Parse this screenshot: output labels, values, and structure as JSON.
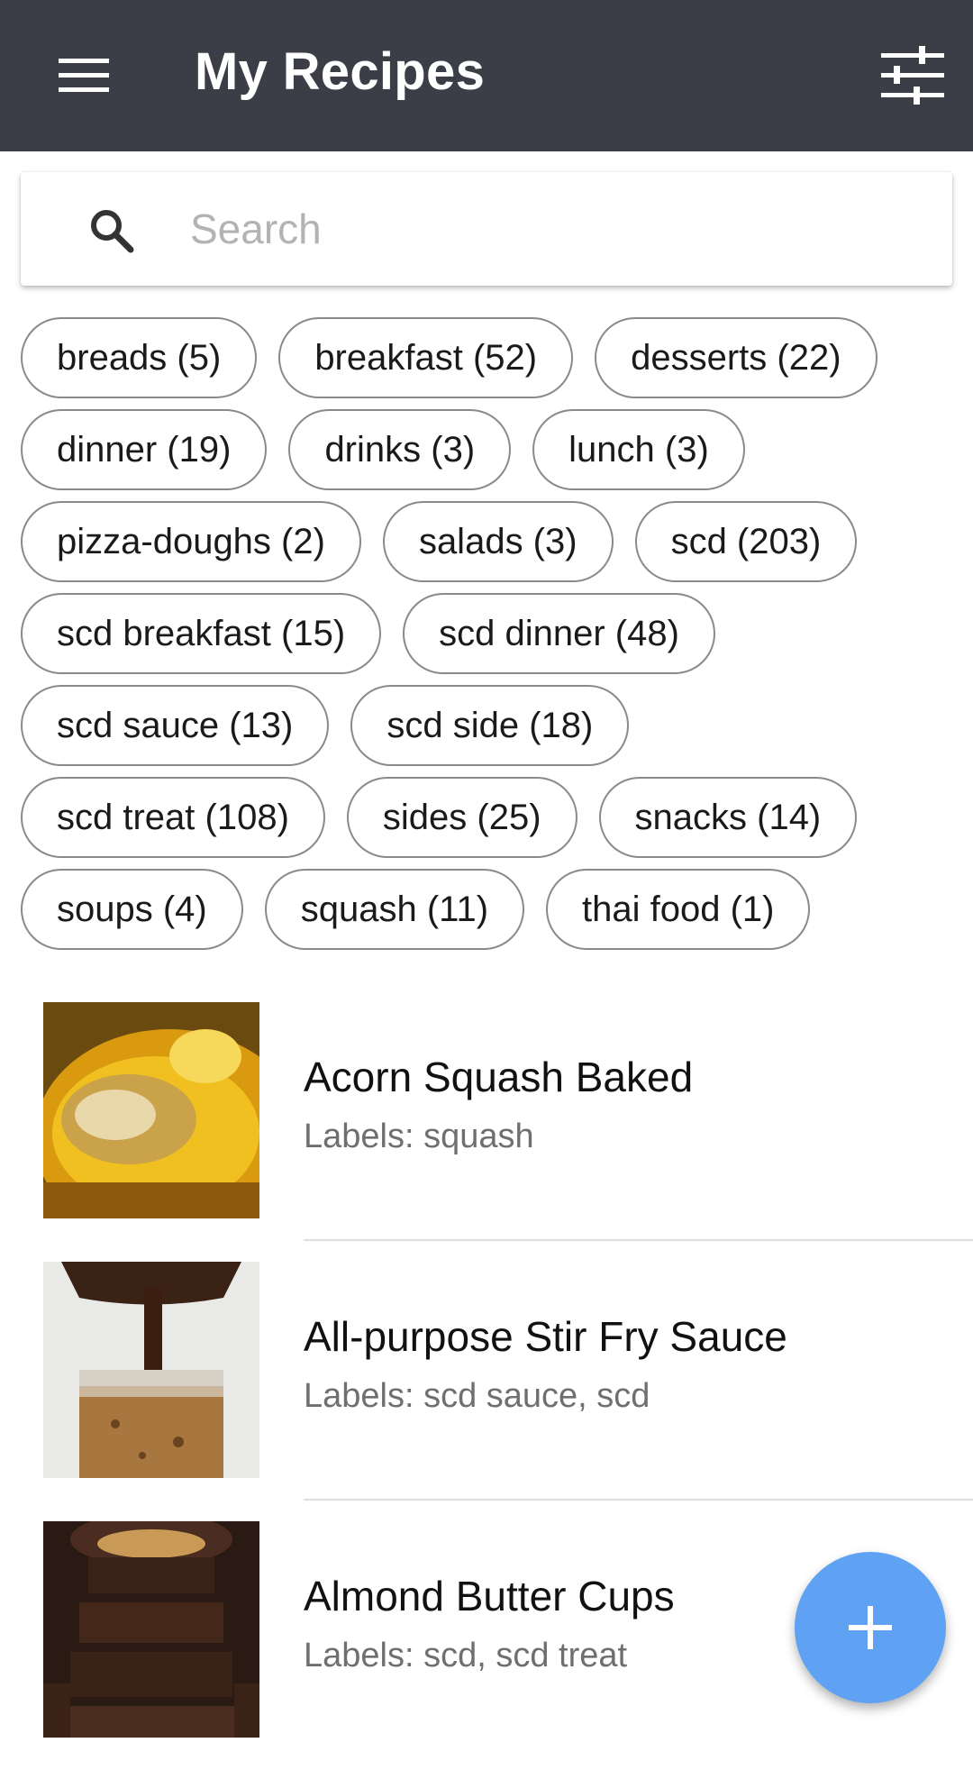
{
  "header": {
    "title": "My Recipes",
    "menu_icon": "hamburger-menu-icon",
    "filter_icon": "sliders-filter-icon",
    "background": "#3b3e47"
  },
  "search": {
    "placeholder": "Search",
    "value": "",
    "icon": "search-icon"
  },
  "categories": {
    "rows": [
      [
        "breads (5)",
        "breakfast (52)",
        "desserts (22)"
      ],
      [
        "dinner (19)",
        "drinks (3)",
        "lunch (3)"
      ],
      [
        "pizza-doughs (2)",
        "salads (3)",
        "scd (203)"
      ],
      [
        "scd breakfast (15)",
        "scd dinner (48)"
      ],
      [
        "scd sauce (13)",
        "scd side (18)"
      ],
      [
        "scd treat (108)",
        "sides (25)",
        "snacks (14)"
      ],
      [
        "soups (4)",
        "squash (11)",
        "thai food (1)"
      ]
    ]
  },
  "recipes": [
    {
      "name": "Acorn Squash Baked",
      "labels": "Labels: squash"
    },
    {
      "name": "All-purpose Stir Fry Sauce",
      "labels": "Labels: scd sauce, scd"
    },
    {
      "name": "Almond Butter Cups",
      "labels": "Labels: scd, scd treat"
    }
  ],
  "fab": {
    "icon": "plus-icon",
    "color": "#5fa2f4"
  }
}
